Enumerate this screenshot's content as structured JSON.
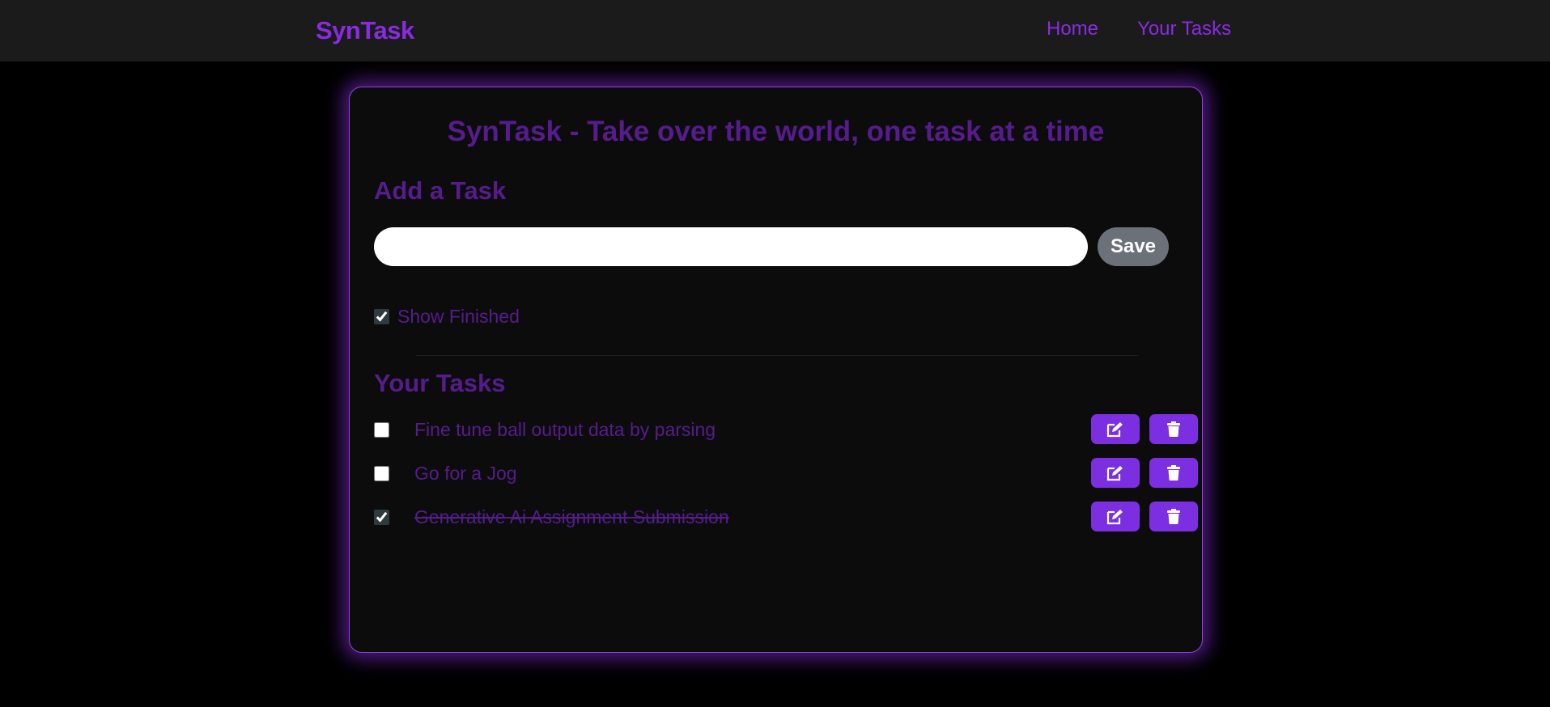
{
  "navbar": {
    "brand": "SynTask",
    "links": [
      {
        "label": "Home"
      },
      {
        "label": "Your Tasks"
      }
    ]
  },
  "card": {
    "title": "SynTask - Take over the world, one task at a time",
    "add_heading": "Add a Task",
    "input": {
      "value": "",
      "placeholder": ""
    },
    "save_label": "Save",
    "show_finished": {
      "label": "Show Finished",
      "checked": true
    },
    "tasks_heading": "Your Tasks",
    "tasks": [
      {
        "text": "Fine tune ball output data by parsing",
        "done": false,
        "edit_icon": "edit-icon",
        "delete_icon": "trash-icon"
      },
      {
        "text": "Go for a Jog",
        "done": false,
        "edit_icon": "edit-icon",
        "delete_icon": "trash-icon"
      },
      {
        "text": "Generative Ai Assignment Submission",
        "done": true,
        "edit_icon": "edit-icon",
        "delete_icon": "trash-icon"
      }
    ]
  },
  "colors": {
    "accent": "#8a2be2",
    "heading": "#561c8d",
    "button": "#7b2fe0",
    "save_button": "#6b7079"
  }
}
